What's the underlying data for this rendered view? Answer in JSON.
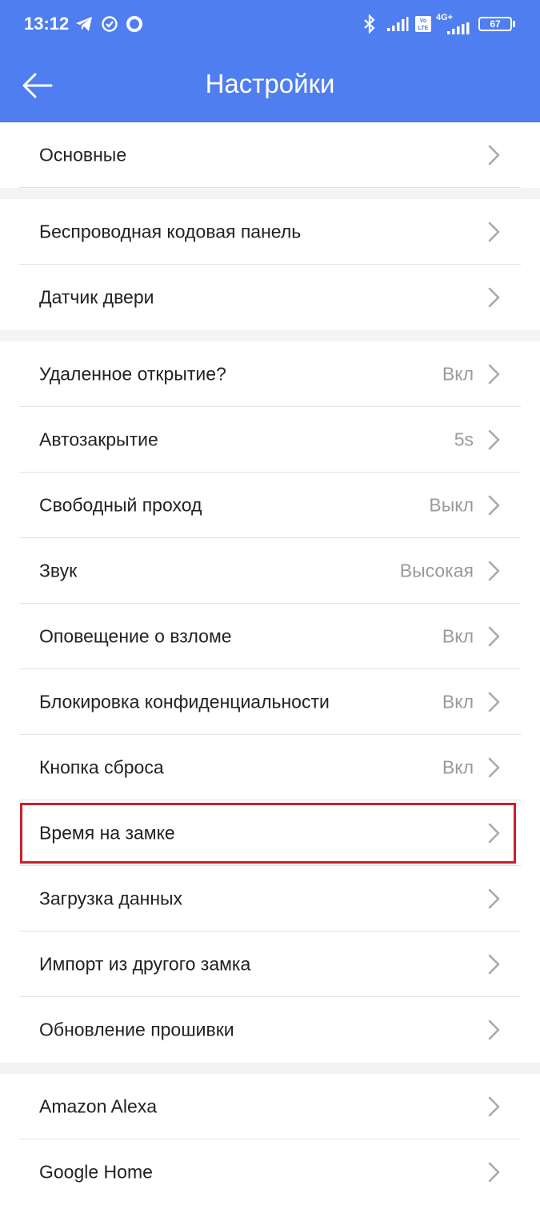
{
  "status_bar": {
    "time": "13:12",
    "battery": "67",
    "network": "4G+",
    "volte": "Vo LTE",
    "icons": [
      "telegram-icon",
      "check-circle-icon",
      "ring-icon",
      "bluetooth-icon",
      "signal-icon",
      "signal-icon"
    ]
  },
  "header": {
    "title": "Настройки",
    "back_icon": "arrow-left-icon"
  },
  "colors": {
    "header": "#4f7ef0",
    "highlight": "#c8202d"
  },
  "groups": [
    {
      "items": [
        {
          "label": "Основные",
          "value": ""
        }
      ]
    },
    {
      "items": [
        {
          "label": "Беспроводная кодовая панель",
          "value": ""
        },
        {
          "label": "Датчик двери",
          "value": ""
        }
      ]
    },
    {
      "items": [
        {
          "label": "Удаленное открытие?",
          "value": "Вкл"
        },
        {
          "label": "Автозакрытие",
          "value": "5s"
        },
        {
          "label": "Свободный проход",
          "value": "Выкл"
        },
        {
          "label": "Звук",
          "value": "Высокая"
        },
        {
          "label": "Оповещение о взломе",
          "value": "Вкл"
        },
        {
          "label": "Блокировка конфиденциальности",
          "value": "Вкл"
        },
        {
          "label": "Кнопка сброса",
          "value": "Вкл"
        },
        {
          "label": "Время на замке",
          "value": "",
          "highlighted": true
        },
        {
          "label": "Загрузка данных",
          "value": ""
        },
        {
          "label": "Импорт из другого замка",
          "value": ""
        },
        {
          "label": "Обновление прошивки",
          "value": ""
        }
      ]
    },
    {
      "items": [
        {
          "label": "Amazon Alexa",
          "value": ""
        },
        {
          "label": "Google Home",
          "value": ""
        }
      ]
    }
  ]
}
